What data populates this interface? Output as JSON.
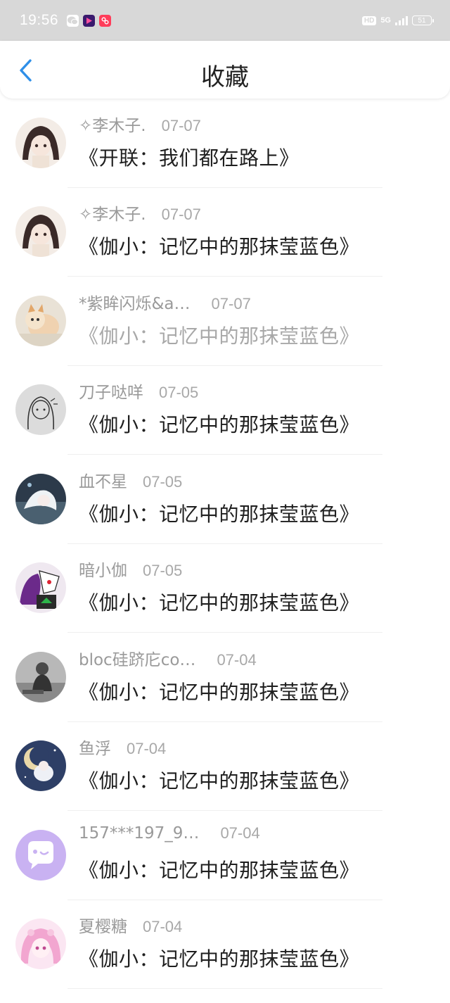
{
  "status_bar": {
    "time": "19:56",
    "network": "5G",
    "hd": "HD",
    "battery": "51",
    "app_icons": [
      "wechat-icon",
      "video-app-icon",
      "camera-app-icon"
    ]
  },
  "header": {
    "title": "收藏",
    "back_icon": "chevron-left-icon"
  },
  "colors": {
    "accent": "#2f8fe8",
    "status_bar_bg": "#d8d8d8",
    "meta_text": "#9a9a9a",
    "title_text": "#1f1f1f"
  },
  "favorites": [
    {
      "user": "",
      "date": "",
      "title": "《伽小：记忆中的那抹莹蓝色》",
      "dimmed": false,
      "avatar": "anime-girl-pink-avatar"
    },
    {
      "user": "✧李木子.",
      "date": "07-07",
      "title": "《开联：我们都在路上》",
      "dimmed": false,
      "avatar": "anime-girl-dark-hair-avatar"
    },
    {
      "user": "✧李木子.",
      "date": "07-07",
      "title": "《伽小：记忆中的那抹莹蓝色》",
      "dimmed": false,
      "avatar": "anime-girl-dark-hair-avatar"
    },
    {
      "user": "*紫眸闪烁&a…",
      "date": "07-07",
      "title": "《伽小：记忆中的那抹莹蓝色》",
      "dimmed": true,
      "avatar": "kitten-avatar"
    },
    {
      "user": "刀子哒咩",
      "date": "07-05",
      "title": "《伽小：记忆中的那抹莹蓝色》",
      "dimmed": false,
      "avatar": "sketch-girl-avatar"
    },
    {
      "user": "血不星",
      "date": "07-05",
      "title": "《伽小：记忆中的那抹莹蓝色》",
      "dimmed": false,
      "avatar": "white-hair-anime-avatar"
    },
    {
      "user": "暗小伽",
      "date": "07-05",
      "title": "《伽小：记忆中的那抹莹蓝色》",
      "dimmed": false,
      "avatar": "purple-character-avatar"
    },
    {
      "user": "bloc硅跻庀co…",
      "date": "07-04",
      "title": "《伽小：记忆中的那抹莹蓝色》",
      "dimmed": false,
      "avatar": "grayscale-photo-avatar"
    },
    {
      "user": "鱼浮",
      "date": "07-04",
      "title": "《伽小：记忆中的那抹莹蓝色》",
      "dimmed": false,
      "avatar": "moon-night-avatar"
    },
    {
      "user": "157***197_9…",
      "date": "07-04",
      "title": "《伽小：记忆中的那抹莹蓝色》",
      "dimmed": false,
      "avatar": "default-chat-bubble-avatar"
    },
    {
      "user": "夏樱糖",
      "date": "07-04",
      "title": "《伽小：记忆中的那抹莹蓝色》",
      "dimmed": false,
      "avatar": "pink-anime-girl-avatar"
    }
  ]
}
